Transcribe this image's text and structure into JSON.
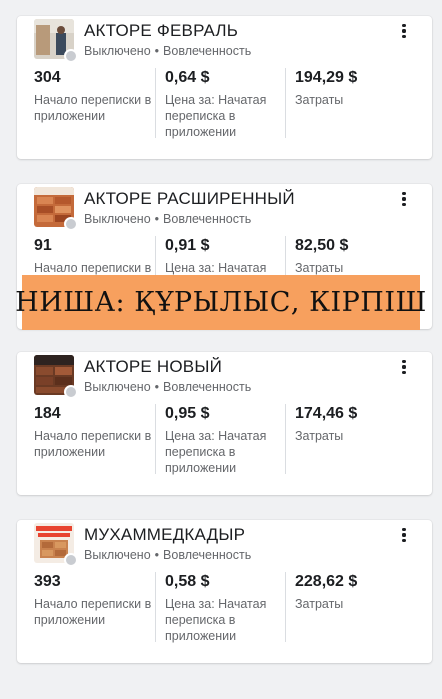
{
  "campaigns": [
    {
      "title": "АКТОРЕ ФЕВРАЛЬ",
      "status": "Выключено",
      "goal": "Вовлеченность",
      "separator": "•",
      "metrics": [
        {
          "value": "304",
          "label": "Начало переписки в приложении"
        },
        {
          "value": "0,64 $",
          "label": "Цена за: Начатая переписка в приложении"
        },
        {
          "value": "194,29 $",
          "label": "Затраты"
        }
      ]
    },
    {
      "title": "АКТОРЕ РАСШИРЕННЫЙ",
      "status": "Выключено",
      "goal": "Вовлеченность",
      "separator": "•",
      "metrics": [
        {
          "value": "91",
          "label": "Начало переписки в"
        },
        {
          "value": "0,91 $",
          "label": "Цена за: Начатая"
        },
        {
          "value": "82,50 $",
          "label": "Затраты"
        }
      ]
    },
    {
      "title": "АКТОРЕ НОВЫЙ",
      "status": "Выключено",
      "goal": "Вовлеченность",
      "separator": "•",
      "metrics": [
        {
          "value": "184",
          "label": "Начало переписки в приложении"
        },
        {
          "value": "0,95 $",
          "label": "Цена за: Начатая переписка в приложении"
        },
        {
          "value": "174,46 $",
          "label": "Затраты"
        }
      ]
    },
    {
      "title": "МУХАММЕДКАДЫР",
      "status": "Выключено",
      "goal": "Вовлеченность",
      "separator": "•",
      "metrics": [
        {
          "value": "393",
          "label": "Начало переписки в приложении"
        },
        {
          "value": "0,58 $",
          "label": "Цена за: Начатая переписка в приложении"
        },
        {
          "value": "228,62 $",
          "label": "Затраты"
        }
      ]
    }
  ],
  "banner": {
    "text": "НИША: ҚҰРЫЛЫС, КІРПІШ",
    "color": "#f7a05e"
  },
  "colors": {
    "status_dot": "#c9ccd1",
    "muted_text": "#65676b",
    "page_bg": "#f0f1f3"
  }
}
